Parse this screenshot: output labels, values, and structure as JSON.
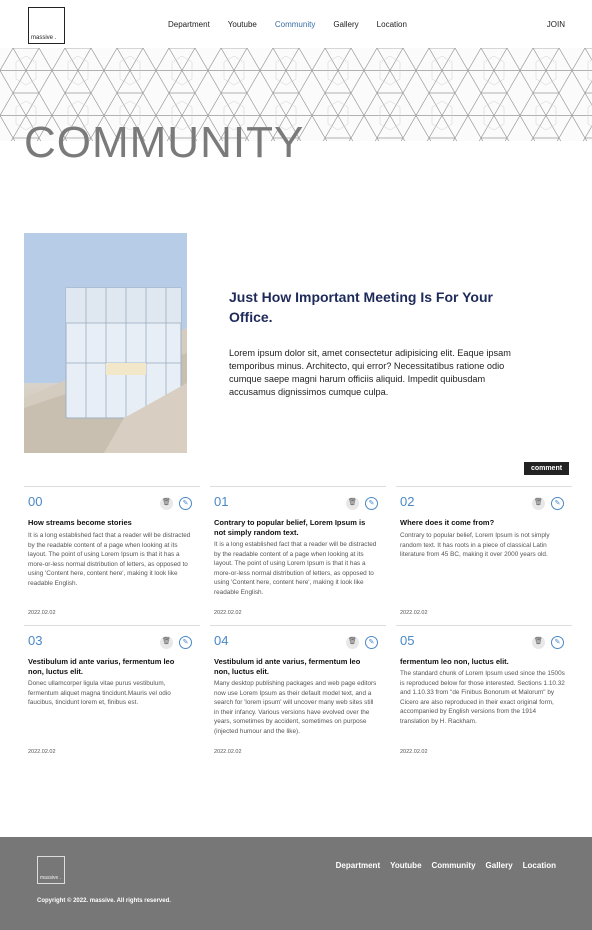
{
  "header": {
    "logo": "massive .",
    "nav": [
      "Department",
      "Youtube",
      "Community",
      "Gallery",
      "Location"
    ],
    "active": "Community",
    "join": "JOIN"
  },
  "hero": {
    "title": "COMMUNITY"
  },
  "feature": {
    "title": "Just How Important Meeting Is For Your Office.",
    "body": "Lorem ipsum dolor sit, amet consectetur adipisicing elit. Eaque ipsam temporibus minus. Architecto, qui error? Necessitatibus ratione odio cumque saepe magni harum officiis aliquid. Impedit quibusdam accusamus dignissimos cumque culpa."
  },
  "comment_button": "comment",
  "cards": [
    {
      "num": "00",
      "title": "How streams become stories",
      "text": "It is a long established fact that a reader will be distracted by the readable content of a page when looking at its layout. The point of using Lorem Ipsum is that it has a more-or-less normal distribution of letters, as opposed to using 'Content here, content here', making it look like readable English.",
      "date": "2022.02.02"
    },
    {
      "num": "01",
      "title": "Contrary to popular belief, Lorem Ipsum is not simply random text.",
      "text": "It is a long established fact that a reader will be distracted by the readable content of a page when looking at its layout. The point of using Lorem Ipsum is that it has a more-or-less normal distribution of letters, as opposed to using 'Content here, content here', making it look like readable English.",
      "date": "2022.02.02"
    },
    {
      "num": "02",
      "title": "Where does it come from?",
      "text": "Contrary to popular belief, Lorem Ipsum is not simply random text. It has roots in a piece of classical Latin literature from 45 BC, making it over 2000 years old.",
      "date": "2022.02.02"
    },
    {
      "num": "03",
      "title": "Vestibulum id ante varius, fermentum leo non, luctus elit.",
      "text": "Donec ullamcorper ligula vitae purus vestibulum, fermentum aliquet magna tincidunt.Mauris vel odio faucibus, tincidunt lorem et, finibus est.",
      "date": "2022.02.02"
    },
    {
      "num": "04",
      "title": "Vestibulum id ante varius, fermentum leo non, luctus elit.",
      "text": "Many desktop publishing packages and web page editors now use Lorem Ipsum as their default model text, and a search for 'lorem ipsum' will uncover many web sites still in their infancy. Various versions have evolved over the years, sometimes by accident, sometimes on purpose (injected humour and the like).",
      "date": "2022.02.02"
    },
    {
      "num": "05",
      "title": "fermentum leo non, luctus elit.",
      "text": "The standard chunk of Lorem Ipsum used since the 1500s is reproduced below for those interested. Sections 1.10.32 and 1.10.33 from \"de Finibus Bonorum et Malorum\" by Cicero are also reproduced in their exact original form, accompanied by English versions from the 1914 translation by H. Rackham.",
      "date": "2022.02.02"
    }
  ],
  "footer": {
    "logo": "massive .",
    "nav": [
      "Department",
      "Youtube",
      "Community",
      "Gallery",
      "Location"
    ],
    "copyright": "Copyright © 2022. massive. All rights reserved."
  },
  "colors": {
    "accent": "#4a88c8",
    "title": "#1e2a5a",
    "footer_bg": "#777777",
    "hero_text": "#7a7a7a"
  }
}
